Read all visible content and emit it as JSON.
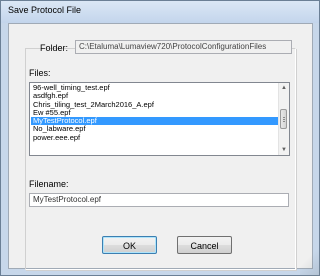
{
  "window": {
    "title": "Save Protocol File"
  },
  "folder": {
    "label": "Folder:",
    "path": "C:\\Etaluma\\Lumaview720\\ProtocolConfigurationFiles"
  },
  "files": {
    "label": "Files:",
    "items": [
      "96-well_timing_test.epf",
      "asdfgh.epf",
      "Chris_tiling_test_2March2016_A.epf",
      "Ew #55.epf",
      "MyTestProtocol.epf",
      "No_labware.epf",
      "power.eee.epf"
    ],
    "selected_index": 4
  },
  "filename": {
    "label": "Filename:",
    "value": "MyTestProtocol.epf"
  },
  "buttons": {
    "ok_label": "OK",
    "cancel_label": "Cancel"
  }
}
